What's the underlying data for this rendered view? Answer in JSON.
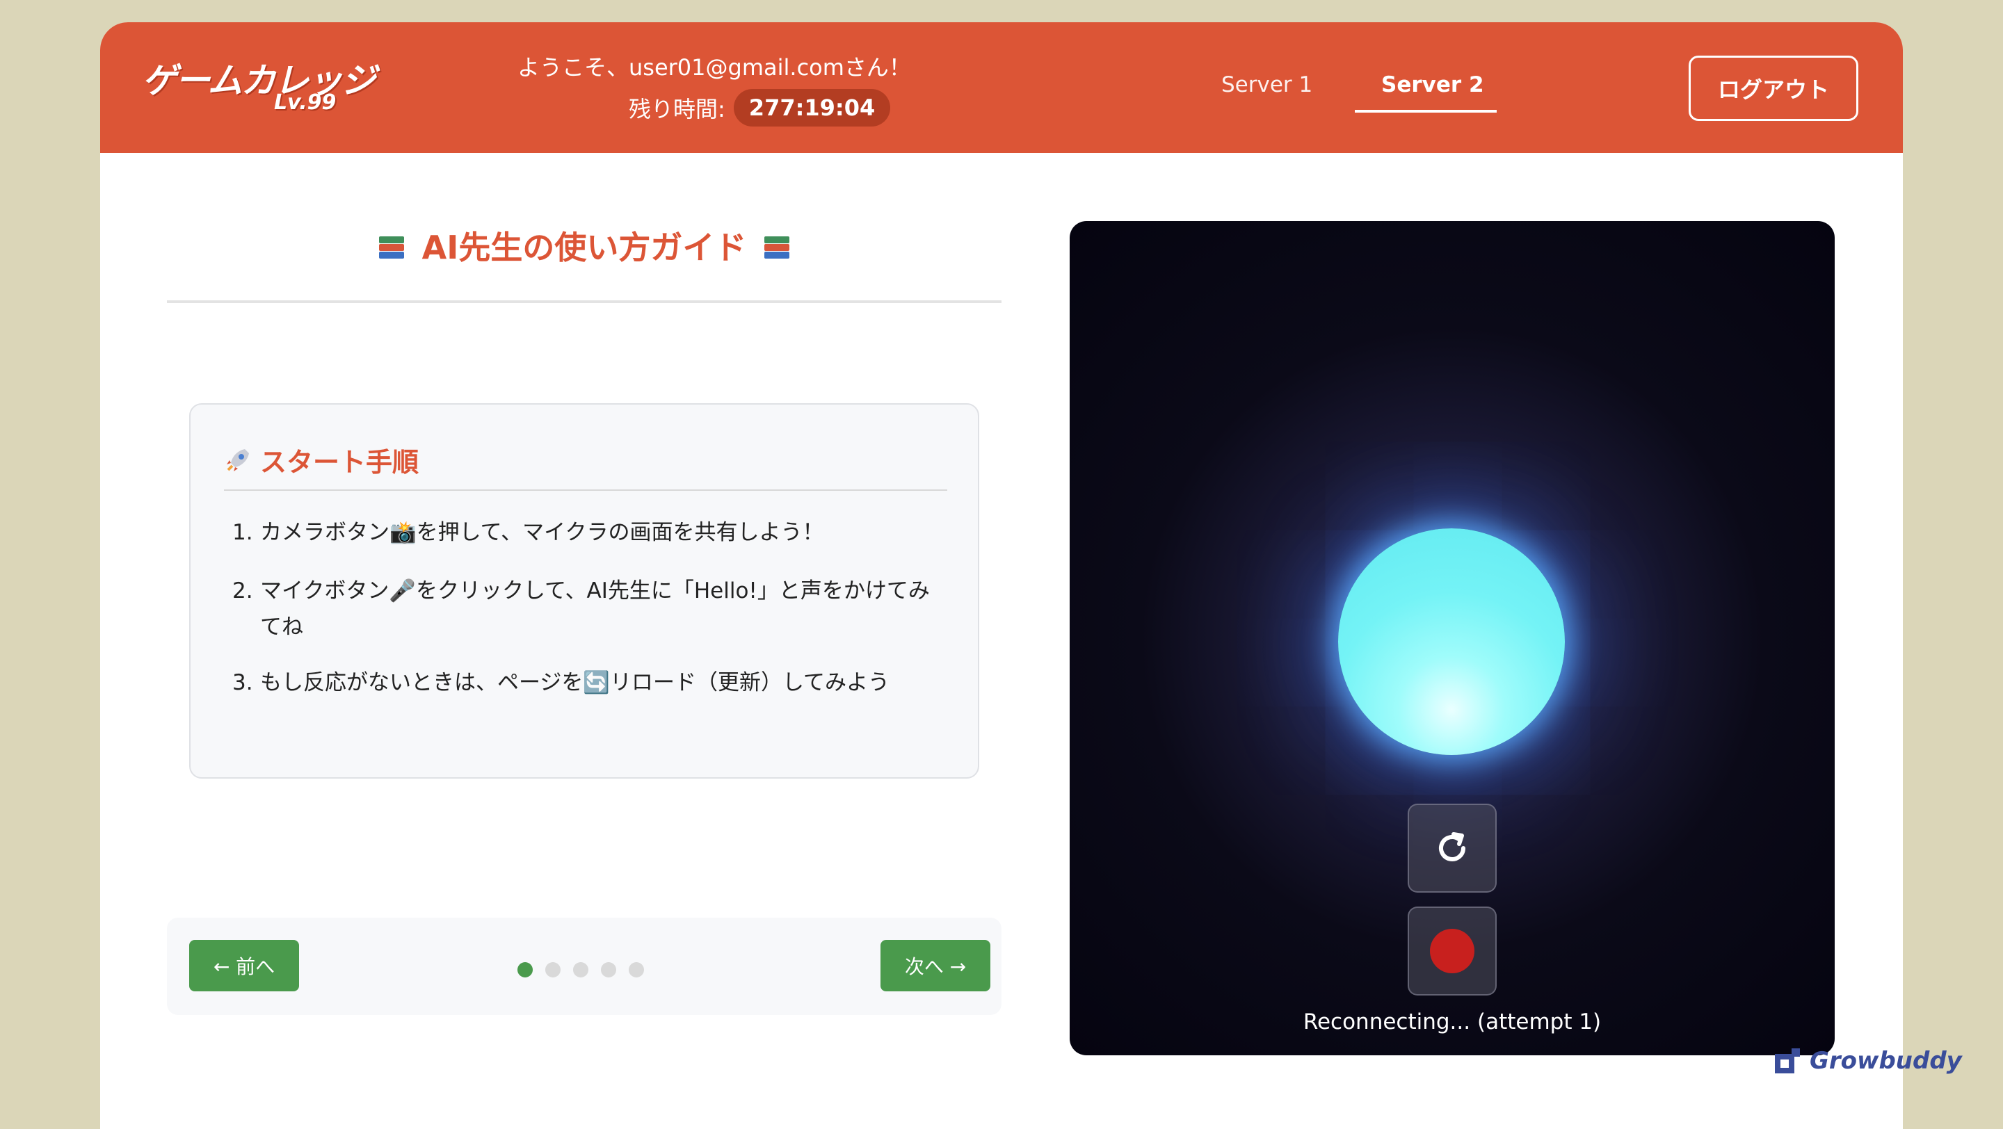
{
  "header": {
    "logo_main": "ゲームカレッジ",
    "logo_sub": "Lv.99",
    "welcome": "ようこそ、user01@gmail.comさん！",
    "remaining_label": "残り時間:",
    "remaining_value": "277:19:04",
    "tabs": [
      {
        "label": "Server 1",
        "active": false
      },
      {
        "label": "Server 2",
        "active": true
      }
    ],
    "logout_label": "ログアウト",
    "accent_color": "#dc5536"
  },
  "guide": {
    "title": "AI先生の使い方ガイド",
    "title_icon": "books-icon",
    "section_title": "スタート手順",
    "section_icon": "rocket-icon",
    "steps": [
      {
        "num": "1.",
        "text": "カメラボタン📸を押して、マイクラの画面を共有しよう！"
      },
      {
        "num": "2.",
        "text": "マイクボタン🎤をクリックして、AI先生に「Hello!」と声をかけてみてね"
      },
      {
        "num": "3.",
        "text": "もし反応がないときは、ページを🔄リロード（更新）してみよう"
      }
    ],
    "prev_label": "← 前へ",
    "next_label": "次へ →",
    "page_count": 5,
    "current_page": 1
  },
  "stage": {
    "reload_icon": "reload-icon",
    "record_icon": "record-icon",
    "status": "Reconnecting... (attempt 1)"
  },
  "brand": {
    "name": "Growbuddy"
  }
}
